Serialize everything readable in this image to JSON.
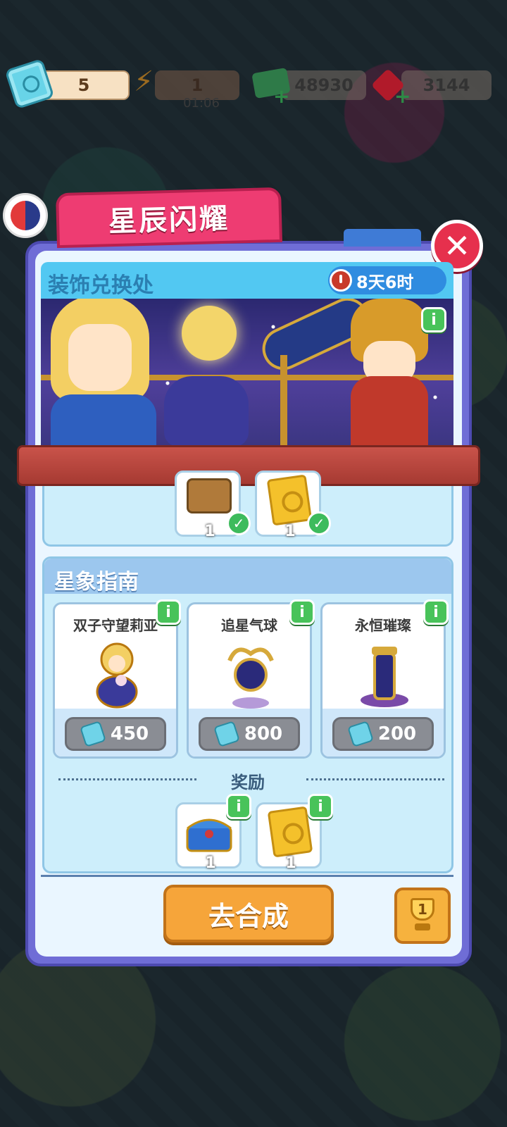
{
  "resources": {
    "tickets": "5",
    "energy": "1",
    "energy_timer": "01:06",
    "cash": "48930",
    "gems": "3144"
  },
  "event": {
    "title": "星辰闪耀",
    "shop_title": "装饰兑换处",
    "time_left": "8天6时"
  },
  "upper_rewards": [
    {
      "icon": "chest-icon",
      "qty": "1",
      "claimed": true
    },
    {
      "icon": "scroll-icon",
      "qty": "1",
      "claimed": true
    }
  ],
  "guide": {
    "title": "星象指南",
    "items": [
      {
        "name": "双子守望莉亚",
        "price": "450",
        "icon": "twin-statue-icon"
      },
      {
        "name": "追星气球",
        "price": "800",
        "icon": "star-balloon-icon"
      },
      {
        "name": "永恒璀璨",
        "price": "200",
        "icon": "eternal-pillar-icon"
      }
    ],
    "reward_label": "奖励",
    "rewards": [
      {
        "icon": "blue-chest-icon",
        "qty": "1"
      },
      {
        "icon": "scroll-icon",
        "qty": "1"
      }
    ]
  },
  "footer": {
    "go_label": "去合成",
    "trophy_count": "1"
  },
  "icons": {
    "info": "i",
    "close": "✕",
    "check": "✓"
  },
  "colors": {
    "accent": "#ee3c72",
    "panel": "#6f6dd6",
    "go_button": "#f6a53a",
    "info_green": "#48c35a"
  }
}
